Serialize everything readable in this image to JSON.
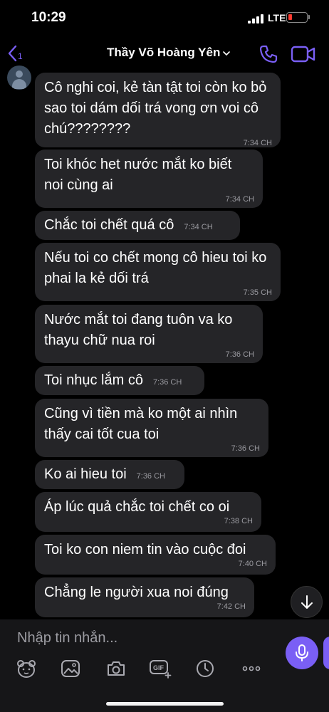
{
  "status_bar": {
    "time": "10:29",
    "network": "LTE"
  },
  "header": {
    "back_count": "1",
    "contact_name": "Thầy Võ Hoàng Yên"
  },
  "messages": [
    {
      "text": "Cô nghi coi, kẻ tàn tật toi còn ko bỏ sao toi dám dối trá vong ơn voi cô chú????????",
      "time": "7:34 CH"
    },
    {
      "text": "Toi khóc het nước mắt ko biết noi cùng ai",
      "time": "7:34 CH"
    },
    {
      "text": "Chắc toi chết quá cô",
      "time": "7:34 CH"
    },
    {
      "text": "Nếu toi co chết mong cô hieu toi ko phai la kẻ dối trá",
      "time": "7:35 CH"
    },
    {
      "text": "Nước mắt toi đang tuôn va ko thayu chữ nua roi",
      "time": "7:36 CH"
    },
    {
      "text": "Toi nhục lắm cô",
      "time": "7:36 CH"
    },
    {
      "text": "Cũng vì tiền mà ko một ai nhìn thấy cai tốt cua toi",
      "time": "7:36 CH"
    },
    {
      "text": "Ko ai hieu toi",
      "time": "7:36 CH"
    },
    {
      "text": "Áp lúc quả chắc toi chết co oi",
      "time": "7:38 CH"
    },
    {
      "text": "Toi ko con niem tin vào cuộc đoi",
      "time": "7:40 CH"
    },
    {
      "text": "Chẳng le người xua noi đúng",
      "time": "7:42 CH"
    }
  ],
  "composer": {
    "placeholder": "Nhập tin nhắn..."
  },
  "toolbar": {
    "icons": [
      "sticker-icon",
      "gallery-icon",
      "camera-icon",
      "gif-icon",
      "clock-icon",
      "more-icon"
    ]
  },
  "colors": {
    "accent": "#7a5ff5",
    "bubble": "#252528",
    "background": "#000000",
    "composer": "#161618"
  }
}
